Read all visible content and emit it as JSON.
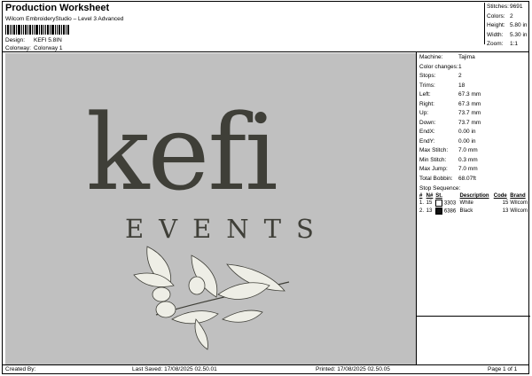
{
  "header": {
    "title": "Production Worksheet",
    "subtitle": "Wilcom EmbroideryStudio – Level 3 Advanced",
    "design_label": "Design:",
    "design_value": "KEFI 5.8IN",
    "colorway_label": "Colorway:",
    "colorway_value": "Colorway 1"
  },
  "top_stats": [
    {
      "label": "Stitches:",
      "value": "9691"
    },
    {
      "label": "Colors:",
      "value": "2"
    },
    {
      "label": "Height:",
      "value": "5.80 in"
    },
    {
      "label": "Width:",
      "value": "5.30 in"
    },
    {
      "label": "Zoom:",
      "value": "1:1"
    }
  ],
  "machine_stats": [
    {
      "label": "Machine:",
      "value": "Tajima"
    },
    {
      "label": "Color changes:",
      "value": "1"
    },
    {
      "label": "Stops:",
      "value": "2"
    },
    {
      "label": "Trims:",
      "value": "18"
    },
    {
      "label": "Left:",
      "value": "67.3 mm"
    },
    {
      "label": "Right:",
      "value": "67.3 mm"
    },
    {
      "label": "Up:",
      "value": "73.7 mm"
    },
    {
      "label": "Down:",
      "value": "73.7 mm"
    },
    {
      "label": "EndX:",
      "value": "0.00 in"
    },
    {
      "label": "EndY:",
      "value": "0.00 in"
    },
    {
      "label": "Max Stitch:",
      "value": "7.0 mm"
    },
    {
      "label": "Min Stitch:",
      "value": "0.3 mm"
    },
    {
      "label": "Max Jump:",
      "value": "7.0 mm"
    },
    {
      "label": "Total Bobbin:",
      "value": "68.07ft"
    }
  ],
  "stop_sequence": {
    "heading": "Stop Sequence:",
    "columns": [
      "#",
      "N#",
      "St.",
      "Description",
      "Code",
      "Brand"
    ],
    "rows": [
      {
        "num": "1.",
        "n": "15",
        "swatch": "#ffffff",
        "st": "3303",
        "desc": "White",
        "code": "15",
        "brand": "Wilcom"
      },
      {
        "num": "2.",
        "n": "13",
        "swatch": "#111111",
        "st": "6386",
        "desc": "Black",
        "code": "13",
        "brand": "Wilcom"
      }
    ]
  },
  "design_preview": {
    "background": "#c0c0c0",
    "logo_word": "kefi",
    "tagline": "EVENTS",
    "thread_dark": "#3f3f38",
    "thread_light": "#eeeee6"
  },
  "footer": {
    "created_by": "Created By:",
    "last_saved": "Last Saved: 17/08/2025 02.50.01",
    "printed": "Printed: 17/08/2025 02.50.05",
    "page": "Page 1 of 1"
  }
}
